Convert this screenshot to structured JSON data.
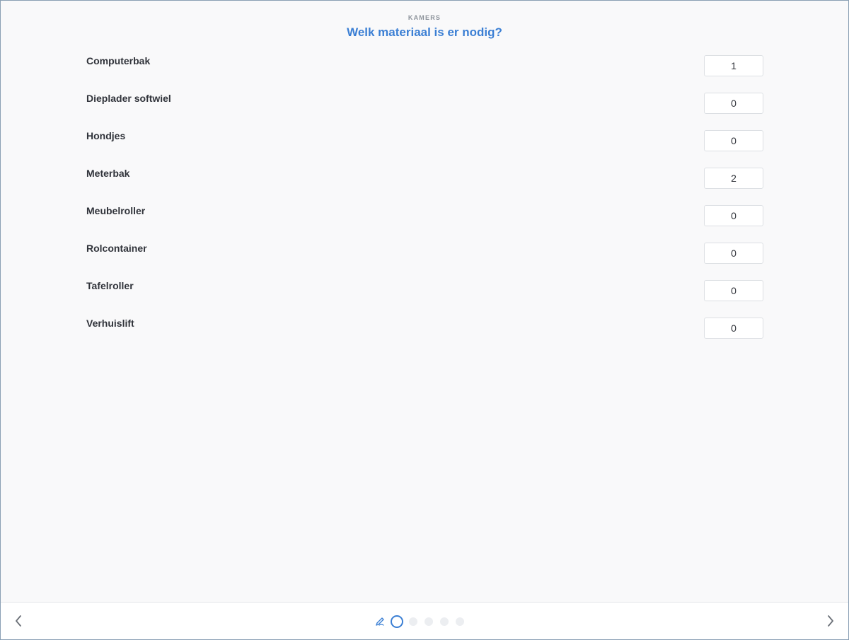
{
  "header": {
    "section": "KAMERS",
    "title": "Welk materiaal is er nodig?"
  },
  "materials": [
    {
      "label": "Computerbak",
      "value": "1"
    },
    {
      "label": "Dieplader softwiel",
      "value": "0"
    },
    {
      "label": "Hondjes",
      "value": "0"
    },
    {
      "label": "Meterbak",
      "value": "2"
    },
    {
      "label": "Meubelroller",
      "value": "0"
    },
    {
      "label": "Rolcontainer",
      "value": "0"
    },
    {
      "label": "Tafelroller",
      "value": "0"
    },
    {
      "label": "Verhuislift",
      "value": "0"
    }
  ],
  "footer": {
    "prev_icon": "chevron-left-icon",
    "next_icon": "chevron-right-icon",
    "pen_icon": "pen-icon",
    "pages": 5,
    "current_page": 1
  },
  "colors": {
    "accent": "#3b7fd4",
    "text": "#30333a",
    "muted": "#8e949c",
    "background": "#f9f9fa"
  }
}
